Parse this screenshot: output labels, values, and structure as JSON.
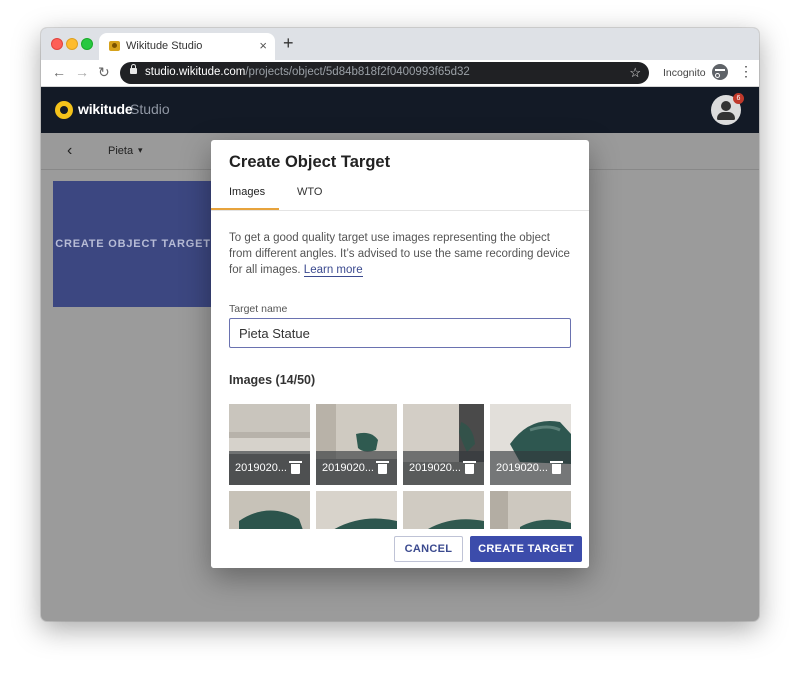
{
  "browser": {
    "tab_title": "Wikitude Studio",
    "tab_close": "×",
    "new_tab": "+",
    "back": "←",
    "forward": "→",
    "reload": "↻",
    "url_host": "studio.wikitude.com",
    "url_path": "/projects/object/5d84b818f2f0400993f65d32",
    "star": "☆",
    "mode_label": "Incognito",
    "menu": "⋮"
  },
  "app": {
    "logo_text": "wikitude",
    "logo_sub": "Studio",
    "notification_count": "6"
  },
  "subbar": {
    "back": "‹",
    "project_name": "Pieta",
    "caret": "▾"
  },
  "background_card": {
    "label": "CREATE OBJECT TARGET"
  },
  "dialog": {
    "title": "Create Object Target",
    "tabs": [
      {
        "label": "Images",
        "active": true
      },
      {
        "label": "WTO",
        "active": false
      }
    ],
    "description": "To get a good quality target use images representing the object from different angles. It’s advised to use the same recording device for all images.",
    "learn_more": "Learn more",
    "target_name_label": "Target name",
    "target_name_value": "Pieta Statue",
    "images_title": "Images (14/50)",
    "images": [
      {
        "caption": "2019020..."
      },
      {
        "caption": "2019020..."
      },
      {
        "caption": "2019020..."
      },
      {
        "caption": "2019020..."
      }
    ],
    "cancel_label": "CANCEL",
    "create_label": "CREATE TARGET"
  },
  "colors": {
    "accent": "#3c4cab",
    "tab_indicator": "#e7a33c",
    "appbar": "#131a26",
    "card": "#3c4781"
  }
}
